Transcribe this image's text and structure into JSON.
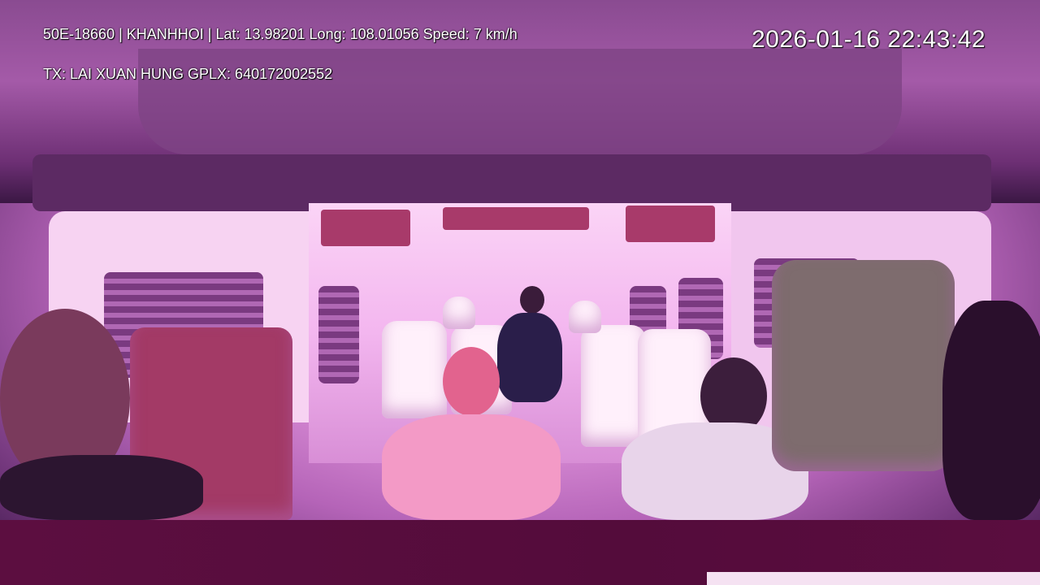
{
  "overlay": {
    "vehicle_info": "50E-18660 | KHANHHOI | Lat: 13.98201 Long: 108.01056 Speed: 7 km/h",
    "driver_info": "TX: LAI XUAN HUNG GPLX: 640172002552",
    "timestamp": "2026-01-16 22:43:42"
  }
}
